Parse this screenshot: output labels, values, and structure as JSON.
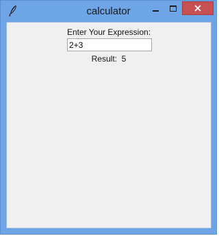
{
  "window": {
    "title": "calculator",
    "icon": "feather-icon",
    "controls": {
      "minimize_icon": "minimize-icon",
      "maximize_icon": "maximize-icon",
      "close_icon": "close-icon"
    }
  },
  "form": {
    "prompt_label": "Enter Your Expression:",
    "expression_value": "2+3",
    "result_label": "Result:",
    "result_value": "5"
  },
  "colors": {
    "frame": "#6ea5e6",
    "client_bg": "#f0f0f0",
    "close_button": "#c75050"
  }
}
